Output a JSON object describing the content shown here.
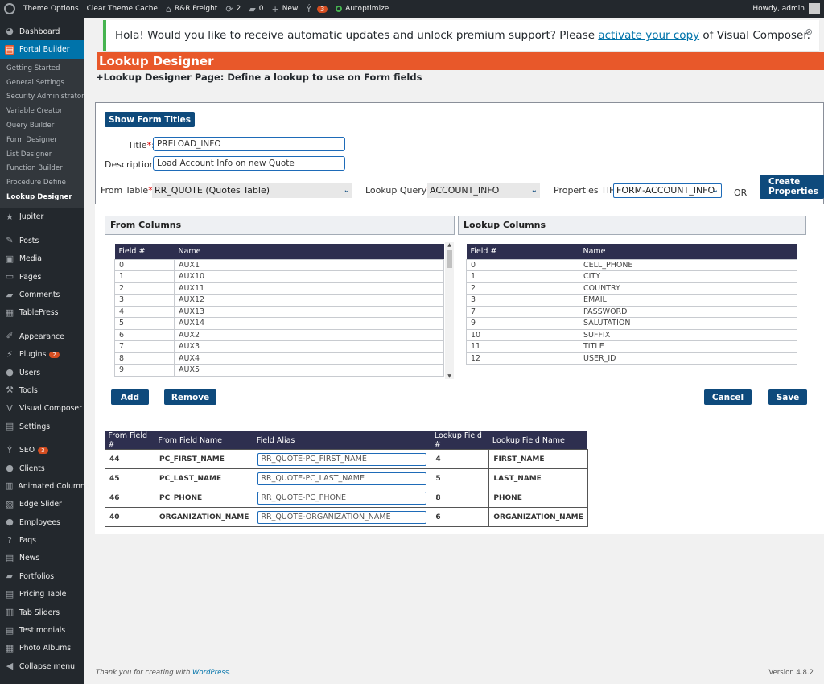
{
  "adminbar": {
    "theme_options": "Theme Options",
    "clear_cache": "Clear Theme Cache",
    "site_name": "R&R Freight",
    "updates_count": "2",
    "comments_count": "0",
    "new_label": "New",
    "seo_count": "3",
    "autoptimize": "Autoptimize",
    "greeting": "Howdy, admin"
  },
  "sidebar": {
    "dashboard": "Dashboard",
    "portal_builder": "Portal Builder",
    "sub_items": [
      "Getting Started",
      "General Settings",
      "Security Administrator",
      "Variable Creator",
      "Query Builder",
      "Form Designer",
      "List Designer",
      "Function Builder",
      "Procedure Define",
      "Lookup Designer"
    ],
    "items": [
      {
        "label": "Jupiter",
        "icon": "star-icon"
      },
      {
        "label": "Posts",
        "icon": "pin-icon"
      },
      {
        "label": "Media",
        "icon": "media-icon"
      },
      {
        "label": "Pages",
        "icon": "page-icon"
      },
      {
        "label": "Comments",
        "icon": "comment-icon"
      },
      {
        "label": "TablePress",
        "icon": "table-icon"
      },
      {
        "label": "Appearance",
        "icon": "brush-icon"
      },
      {
        "label": "Plugins",
        "icon": "plugin-icon",
        "badge": "2"
      },
      {
        "label": "Users",
        "icon": "user-icon"
      },
      {
        "label": "Tools",
        "icon": "wrench-icon"
      },
      {
        "label": "Visual Composer",
        "icon": "vc-icon"
      },
      {
        "label": "Settings",
        "icon": "settings-icon"
      },
      {
        "label": "SEO",
        "icon": "seo-icon",
        "badge": "3"
      },
      {
        "label": "Clients",
        "icon": "clients-icon"
      },
      {
        "label": "Animated Columns",
        "icon": "columns-icon"
      },
      {
        "label": "Edge Slider",
        "icon": "slider-icon"
      },
      {
        "label": "Employees",
        "icon": "employees-icon"
      },
      {
        "label": "Faqs",
        "icon": "faq-icon"
      },
      {
        "label": "News",
        "icon": "news-icon"
      },
      {
        "label": "Portfolios",
        "icon": "folder-icon"
      },
      {
        "label": "Pricing Table",
        "icon": "pricing-icon"
      },
      {
        "label": "Tab Sliders",
        "icon": "tabs-icon"
      },
      {
        "label": "Testimonials",
        "icon": "testimonials-icon"
      },
      {
        "label": "Photo Albums",
        "icon": "album-icon"
      },
      {
        "label": "Collapse menu",
        "icon": "collapse-icon"
      }
    ]
  },
  "notice": {
    "text_before": "Hola! Would you like to receive automatic updates and unlock premium support? Please ",
    "link": "activate your copy",
    "text_after": " of Visual Composer."
  },
  "page": {
    "title": "Lookup Designer",
    "subtitle": "+Lookup Designer Page: Define a lookup to use on Form fields"
  },
  "form": {
    "show_titles_btn": "Show Form Titles",
    "title_label": "Title",
    "title_value": "PRELOAD_INFO",
    "description_label": "Description:",
    "description_value": "Load Account Info on new Quote",
    "from_table_label": "From Table",
    "from_table_value": "RR_QUOTE (Quotes Table)",
    "lookup_query_label": "Lookup Query",
    "lookup_query_value": "ACCOUNT_INFO",
    "properties_tif_label": "Properties TIF:",
    "properties_tif_value": "FORM-ACCOUNT_INFO",
    "or_label": "OR",
    "create_properties_btn": "Create Properties"
  },
  "from_columns": {
    "title": "From Columns",
    "headers": [
      "Field #",
      "Name"
    ],
    "rows": [
      [
        "0",
        "AUX1"
      ],
      [
        "1",
        "AUX10"
      ],
      [
        "2",
        "AUX11"
      ],
      [
        "3",
        "AUX12"
      ],
      [
        "4",
        "AUX13"
      ],
      [
        "5",
        "AUX14"
      ],
      [
        "6",
        "AUX2"
      ],
      [
        "7",
        "AUX3"
      ],
      [
        "8",
        "AUX4"
      ],
      [
        "9",
        "AUX5"
      ]
    ]
  },
  "lookup_columns": {
    "title": "Lookup Columns",
    "headers": [
      "Field #",
      "Name"
    ],
    "rows": [
      [
        "0",
        "CELL_PHONE"
      ],
      [
        "1",
        "CITY"
      ],
      [
        "2",
        "COUNTRY"
      ],
      [
        "3",
        "EMAIL"
      ],
      [
        "7",
        "PASSWORD"
      ],
      [
        "9",
        "SALUTATION"
      ],
      [
        "10",
        "SUFFIX"
      ],
      [
        "11",
        "TITLE"
      ],
      [
        "12",
        "USER_ID"
      ]
    ]
  },
  "actions": {
    "add": "Add",
    "remove": "Remove",
    "cancel": "Cancel",
    "save": "Save"
  },
  "mapping": {
    "headers": [
      "From Field #",
      "From Field Name",
      "Field Alias",
      "Lookup Field #",
      "Lookup Field Name"
    ],
    "rows": [
      [
        "44",
        "PC_FIRST_NAME",
        "RR_QUOTE-PC_FIRST_NAME",
        "4",
        "FIRST_NAME"
      ],
      [
        "45",
        "PC_LAST_NAME",
        "RR_QUOTE-PC_LAST_NAME",
        "5",
        "LAST_NAME"
      ],
      [
        "46",
        "PC_PHONE",
        "RR_QUOTE-PC_PHONE",
        "8",
        "PHONE"
      ],
      [
        "40",
        "ORGANIZATION_NAME",
        "RR_QUOTE-ORGANIZATION_NAME",
        "6",
        "ORGANIZATION_NAME"
      ]
    ]
  },
  "footer": {
    "thanks_before": "Thank you for creating with ",
    "thanks_link": "WordPress",
    "thanks_after": ".",
    "version": "Version 4.8.2"
  }
}
